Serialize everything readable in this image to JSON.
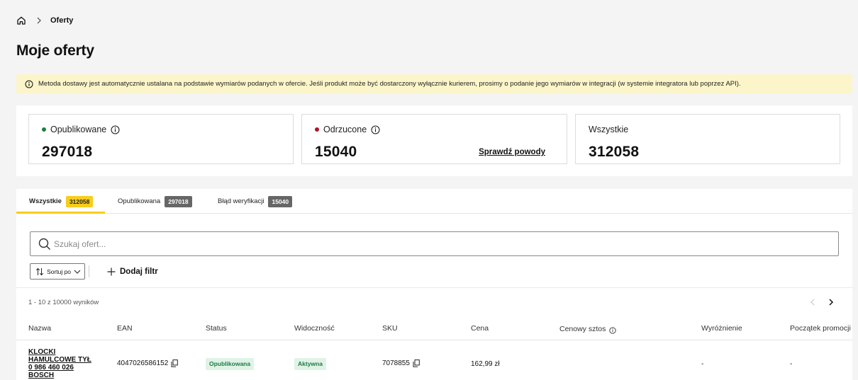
{
  "breadcrumb": {
    "current": "Oferty"
  },
  "page": {
    "title": "Moje oferty"
  },
  "banner": {
    "text": "Metoda dostawy jest automatycznie ustalana na podstawie wymiarów podanych w ofercie. Jeśli produkt może być dostarczony wyłącznie kurierem, prosimy o podanie jego wymiarów w integracji (w systemie integratora lub poprzez API)."
  },
  "stats": {
    "published": {
      "label": "Opublikowane",
      "value": "297018",
      "dot_color": "#1a7f3c"
    },
    "rejected": {
      "label": "Odrzucone",
      "value": "15040",
      "link": "Sprawdź powody",
      "dot_color": "#b0102b"
    },
    "all": {
      "label": "Wszystkie",
      "value": "312058"
    }
  },
  "tabs": [
    {
      "label": "Wszystkie",
      "count": "312058"
    },
    {
      "label": "Opublikowana",
      "count": "297018"
    },
    {
      "label": "Błąd weryfikacji",
      "count": "15040"
    }
  ],
  "search": {
    "placeholder": "Szukaj ofert..."
  },
  "toolbar": {
    "sort_label": "Sortuj po",
    "add_filter_label": "Dodaj filtr"
  },
  "results": {
    "summary": "1 - 10 z 10000 wyników"
  },
  "table": {
    "headers": [
      "Nazwa",
      "EAN",
      "Status",
      "Widoczność",
      "SKU",
      "Cena",
      "Cenowy sztos",
      "Wyróżnienie",
      "Początek promocji"
    ],
    "rows": [
      {
        "name": "KLOCKI HAMULCOWE TYŁ 0 986 460 026 BOSCH",
        "ean": "4047026586152",
        "status": "Opublikowana",
        "visibility": "Aktywna",
        "sku": "7078855",
        "price": "162,99 zł",
        "highlight": "-",
        "promo_start": "-"
      }
    ]
  },
  "colors": {
    "accent": "#f7cd1c",
    "banner_bg": "#fbf5c9",
    "pill_bg": "#dff3e6",
    "pill_text": "#1f7a45"
  }
}
